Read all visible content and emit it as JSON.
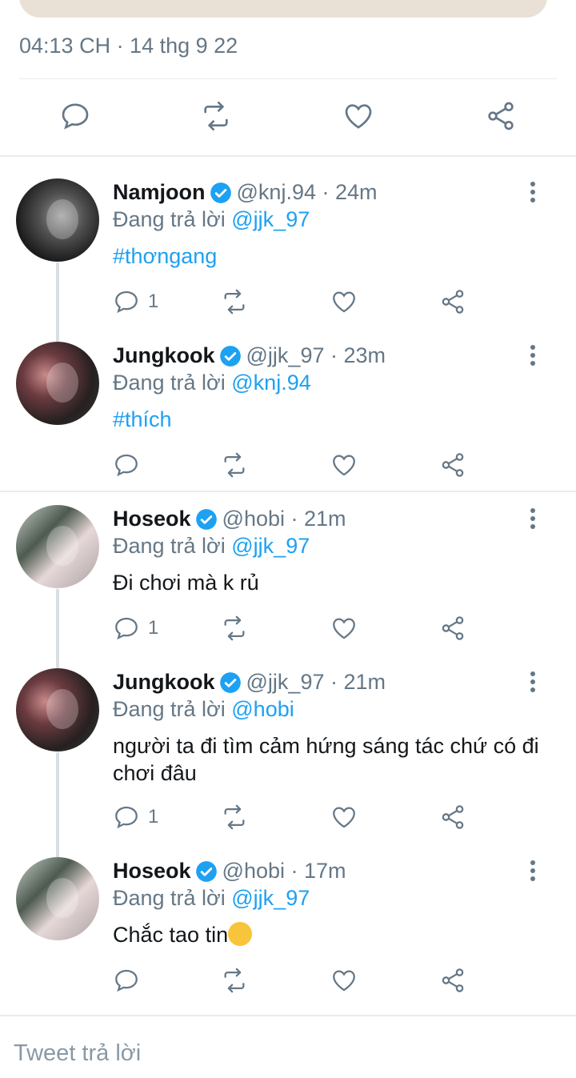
{
  "detail": {
    "timestamp": "04:13 CH · 14 thg 9 22"
  },
  "colors": {
    "accent": "#1da1f2",
    "muted": "#657786",
    "divider": "#e6ecf0"
  },
  "replies": [
    {
      "name": "Namjoon",
      "handle": "@knj.94",
      "time": "24m",
      "replying_prefix": "Đang trả lời ",
      "replying_to": "@jjk_97",
      "text": "#thơngang",
      "reply_count": "1"
    },
    {
      "name": "Jungkook",
      "handle": "@jjk_97",
      "time": "23m",
      "replying_prefix": "Đang trả lời ",
      "replying_to": "@knj.94",
      "text": "#thích",
      "reply_count": ""
    },
    {
      "name": "Hoseok",
      "handle": "@hobi",
      "time": "21m",
      "replying_prefix": "Đang trả lời ",
      "replying_to": "@jjk_97",
      "text": "Đi chơi mà k rủ",
      "reply_count": "1"
    },
    {
      "name": "Jungkook",
      "handle": "@jjk_97",
      "time": "21m",
      "replying_prefix": "Đang trả lời ",
      "replying_to": "@hobi",
      "text": "người ta đi tìm cảm hứng sáng tác chứ có đi chơi đâu",
      "reply_count": "1"
    },
    {
      "name": "Hoseok",
      "handle": "@hobi",
      "time": "17m",
      "replying_prefix": "Đang trả lời ",
      "replying_to": "@jjk_97",
      "text": "Chắc tao tin",
      "reply_count": ""
    }
  ],
  "separator": " · ",
  "compose": {
    "placeholder": "Tweet trả lời"
  }
}
